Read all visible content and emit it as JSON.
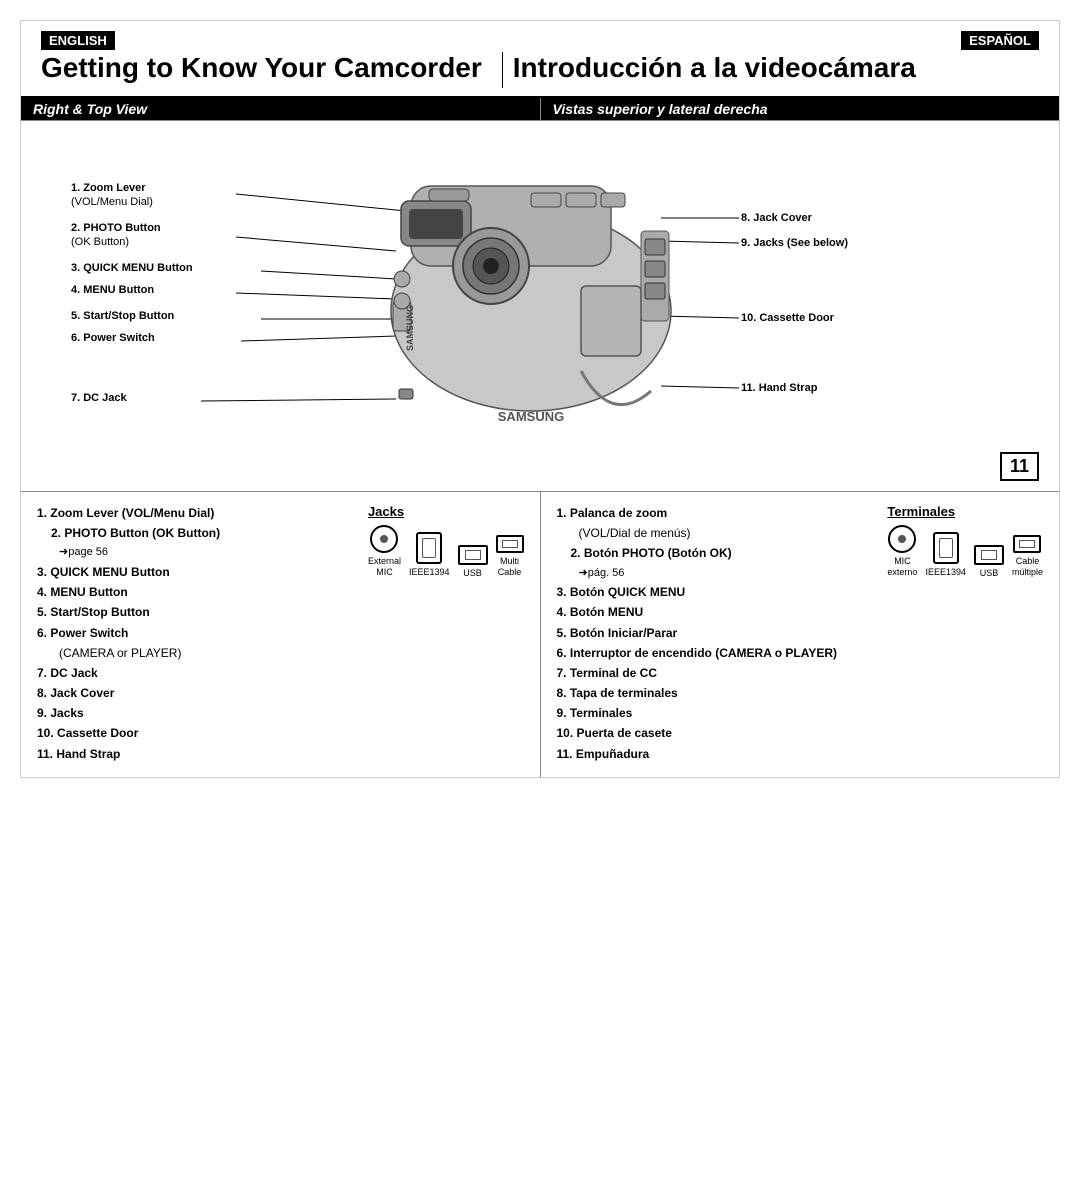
{
  "page": {
    "number": "11",
    "lang_en": "ENGLISH",
    "lang_es": "ESPAÑOL",
    "title_en": "Getting to Know Your Camcorder",
    "title_es": "Introducción a la videocámara",
    "section_en": "Right & Top View",
    "section_es": "Vistas superior y lateral derecha"
  },
  "diagram_labels_left": [
    "1. Zoom Lever",
    "(VOL/Menu Dial)",
    "2. PHOTO Button",
    "(OK Button)",
    "3. QUICK MENU Button",
    "4. MENU Button",
    "5. Start/Stop Button",
    "6. Power Switch",
    "7. DC Jack"
  ],
  "diagram_labels_right": [
    "8. Jack Cover",
    "9. Jacks (See below)",
    "10. Cassette Door",
    "11. Hand Strap"
  ],
  "english_list": {
    "title": "Jacks",
    "items": [
      {
        "num": "1.",
        "bold": true,
        "text": "Zoom Lever (VOL/Menu Dial)"
      },
      {
        "num": "2.",
        "bold": true,
        "text": "PHOTO Button (OK Button)"
      },
      {
        "num": "",
        "bold": false,
        "text": "➜page 56",
        "indent": true
      },
      {
        "num": "3.",
        "bold": true,
        "text": "QUICK MENU Button"
      },
      {
        "num": "4.",
        "bold": true,
        "text": "MENU Button"
      },
      {
        "num": "5.",
        "bold": true,
        "text": "Start/Stop Button"
      },
      {
        "num": "6.",
        "bold": true,
        "text": "Power Switch"
      },
      {
        "num": "",
        "bold": false,
        "text": "(CAMERA or PLAYER)",
        "indent": true
      },
      {
        "num": "7.",
        "bold": true,
        "text": "DC Jack"
      },
      {
        "num": "8.",
        "bold": true,
        "text": "Jack Cover"
      },
      {
        "num": "9.",
        "bold": true,
        "text": "Jacks"
      },
      {
        "num": "10.",
        "bold": true,
        "text": "Cassette Door"
      },
      {
        "num": "11.",
        "bold": true,
        "text": "Hand Strap"
      }
    ],
    "jacks": [
      {
        "label": "External\nMIC",
        "shape": "circle"
      },
      {
        "label": "IEEE1394",
        "shape": "rect"
      },
      {
        "label": "USB",
        "shape": "flat"
      },
      {
        "label": "Multi\nCable",
        "shape": "small"
      }
    ]
  },
  "spanish_list": {
    "title": "Terminales",
    "items": [
      {
        "num": "1.",
        "bold": true,
        "text": "Palanca de zoom"
      },
      {
        "num": "",
        "bold": false,
        "text": "(VOL/Dial de menús)",
        "indent": true
      },
      {
        "num": "2.",
        "bold": true,
        "text": "Botón PHOTO (Botón OK)"
      },
      {
        "num": "",
        "bold": false,
        "text": "➜pág. 56",
        "indent": true
      },
      {
        "num": "3.",
        "bold": true,
        "text": "Botón QUICK MENU"
      },
      {
        "num": "4.",
        "bold": true,
        "text": "Botón MENU"
      },
      {
        "num": "5.",
        "bold": true,
        "text": "Botón Iniciar/Parar"
      },
      {
        "num": "6.",
        "bold": true,
        "text": "Interruptor de encendido (CAMERA o PLAYER)"
      },
      {
        "num": "7.",
        "bold": true,
        "text": "Terminal de CC"
      },
      {
        "num": "8.",
        "bold": true,
        "text": "Tapa de terminales"
      },
      {
        "num": "9.",
        "bold": true,
        "text": "Terminales"
      },
      {
        "num": "10.",
        "bold": true,
        "text": "Puerta de casete"
      },
      {
        "num": "11.",
        "bold": true,
        "text": "Empuñadura"
      }
    ],
    "jacks": [
      {
        "label": "MIC\nexterno",
        "shape": "circle"
      },
      {
        "label": "IEEE1394",
        "shape": "rect"
      },
      {
        "label": "USB",
        "shape": "flat"
      },
      {
        "label": "Cable\nmúltiple",
        "shape": "small"
      }
    ]
  }
}
